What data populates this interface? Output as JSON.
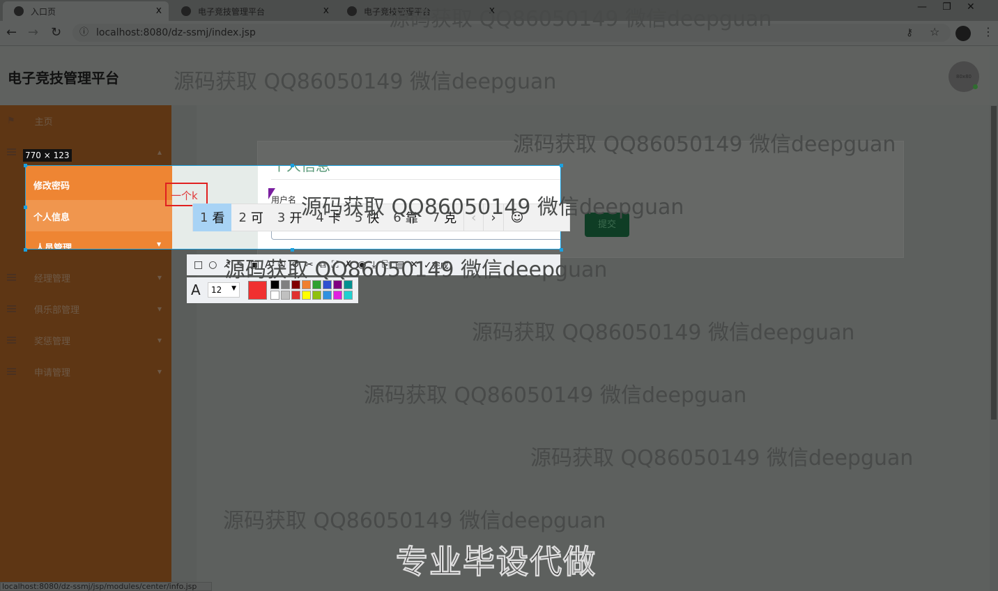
{
  "browser": {
    "tabs": [
      {
        "title": "入口页"
      },
      {
        "title": "电子竞技管理平台"
      },
      {
        "title": "电子竞技管理平台"
      }
    ],
    "url": "localhost:8080/dz-ssmj/index.jsp",
    "status_url": "localhost:8080/dz-ssmj/jsp/modules/center/info.jsp",
    "close": "x"
  },
  "header": {
    "brand": "电子竞技管理平台",
    "avatar": "80x80"
  },
  "sidebar": {
    "items": [
      {
        "label": "主页"
      },
      {
        "label": "修改密码"
      },
      {
        "label": "个人信息"
      },
      {
        "label": "人员管理"
      },
      {
        "label": "经理管理"
      },
      {
        "label": "俱乐部管理"
      },
      {
        "label": "奖惩管理"
      },
      {
        "label": "申请管理"
      }
    ]
  },
  "card": {
    "title": "个人信息",
    "username_label": "用户名",
    "submit": "提交"
  },
  "capture": {
    "size": "770 × 123",
    "typed": "一个k",
    "candidates": [
      {
        "n": "1",
        "c": "看"
      },
      {
        "n": "2",
        "c": "可"
      },
      {
        "n": "3",
        "c": "开"
      },
      {
        "n": "4",
        "c": "卡"
      },
      {
        "n": "5",
        "c": "快"
      },
      {
        "n": "6",
        "c": "靠"
      },
      {
        "n": "7",
        "c": "克"
      }
    ],
    "done": "完成",
    "font_size": "12",
    "colors": [
      "#000000",
      "#808080",
      "#800000",
      "#f08030",
      "#30a030",
      "#3050d0",
      "#800080",
      "#009090",
      "#ffffff",
      "#c0c0c0",
      "#e03030",
      "#ffff00",
      "#90c010",
      "#3090e0",
      "#e020e0",
      "#20d0d0"
    ],
    "current_color": "#f03030"
  },
  "watermark": "源码获取 QQ86050149 微信deepguan",
  "promo": "专业毕设代做"
}
